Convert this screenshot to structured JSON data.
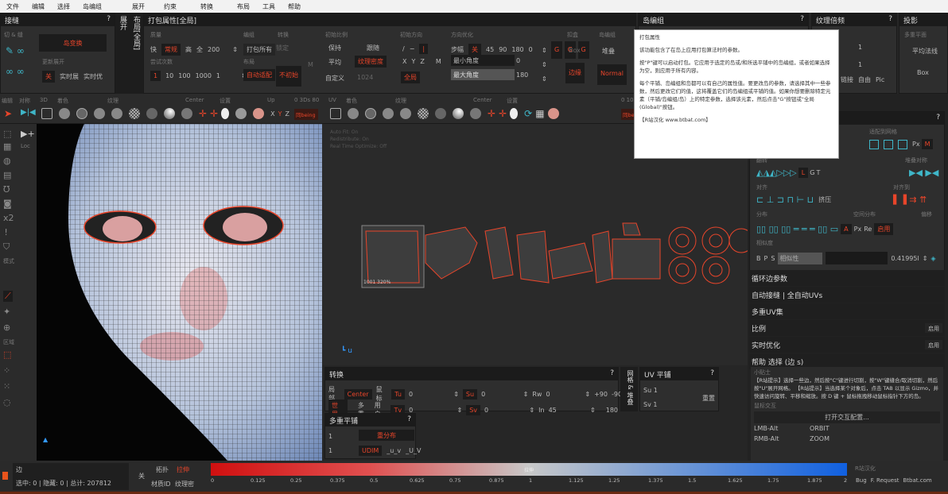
{
  "menu": [
    "文件",
    "编辑",
    "选择",
    "岛编组",
    "展开",
    "约束",
    "转换",
    "布局",
    "工具",
    "帮助"
  ],
  "seams": {
    "title": "接缝",
    "cut_label": "切 & 缝",
    "btn_main": "岛变换",
    "update_label": "更新展开",
    "off": "关",
    "realtime_ui": "实时展",
    "realtime_opt": "实时优"
  },
  "vtabs": {
    "unfold": "展开",
    "layout": "布局[全局]"
  },
  "pack": {
    "title": "打包属性[全局]",
    "quality": "质量",
    "fast": "快",
    "normal": "常规",
    "high": "高",
    "all": "全",
    "count": "200",
    "tries": "尝试次数",
    "tries_vals": [
      "1",
      "10",
      "100",
      "1000",
      "1"
    ],
    "orient": "编组",
    "pack_all": "打包所有",
    "layout": "布局",
    "auto_fit": "自动适配",
    "rotate": "转换",
    "lock": "锁定",
    "no_init": "不初始",
    "m": "M",
    "scale": "初始比例",
    "keep": "保持",
    "follow": "跟随",
    "avg": "平均",
    "tex_density": "纹理密度",
    "custom": "自定义",
    "custom_val": "1024",
    "dir": "初始方向",
    "dirs": [
      "/",
      "−",
      "|"
    ],
    "axes": [
      "X",
      "Y",
      "Z",
      "M"
    ],
    "global": "全局",
    "opt": "方向优化",
    "step": "步幅",
    "step_off": "关",
    "angles": [
      "45",
      "90",
      "180",
      "0"
    ],
    "min_angle": "最小角度",
    "min_val": "0",
    "max_angle": "最大角度",
    "max_val": "180",
    "g": "G",
    "box_h": "扣盒",
    "box": "Box",
    "edge": "边缘",
    "islgroup_h": "岛编组",
    "stack": "堆叠",
    "normal_mode": "Normal"
  },
  "islgroup": {
    "title": "岛编组"
  },
  "texmult": {
    "title": "纹理倍频",
    "v1": "1",
    "v2": "1",
    "b1": "链接",
    "b2": "自由",
    "b3": "Pic"
  },
  "projection": {
    "title": "投影",
    "multi": "多重平面",
    "avg": "平均法线",
    "box": "Box"
  },
  "tooltip": {
    "title": "打包属性",
    "p1": "该功能包含了在岛上应用打包算法时的参数。",
    "p2": "按\"P\"键可以启动打包。它应用于选定的岛或/和所选平铺中的岛编组，或者如果选择为空，则应用于所有内容。",
    "p3": "每个平铺、岛编组和岛都可以有自己的属性值。要更改岛的参数，请选择其中一些参数，然后更改它们的值，这将覆盖它们的岛编组或平铺的值。如果你想要删除特定元素（平铺/岛编组/岛）上的特定参数，选择该元素，然后点击\"G\"按钮或\"全局(Global)\"按钮。",
    "p4": "【R站汉化 www.btbat.com】"
  },
  "view3d": {
    "labels": [
      "编辑",
      "对称",
      "3D",
      "着色",
      "纹理",
      "Center",
      "设置",
      "Up",
      "0 3Ds 80"
    ],
    "axes": [
      "X",
      "Y",
      "Z"
    ],
    "same": "同being",
    "loc": "Loc",
    "x2": "x2",
    "mode": "模式",
    "region": "区域"
  },
  "viewuv": {
    "labels": [
      "UV",
      "着色",
      "纹理",
      "Center",
      "设置",
      "0 10"
    ],
    "info": [
      "Auto Fit: On",
      "Redistribute: On",
      "Real Time Optimize: Off"
    ],
    "tile": "1001 320%",
    "same": "同being"
  },
  "transform": {
    "title": "转换",
    "local": "局部",
    "center": "Center",
    "mouse": "鼠标",
    "world": "世界",
    "multi": "多重",
    "user": "用户",
    "tu": "Tu",
    "tv": "Tv",
    "su": "Su",
    "sv": "Sv",
    "rw": "Rw",
    "in": "In",
    "zero": "0",
    "in_val": "45",
    "p90": "+90",
    "m90": "-90",
    "r180": "180"
  },
  "vtab2": "网格 & 堆叠",
  "uvtile": {
    "title": "UV 平铺",
    "su": "Su 1",
    "sv": "Sv 1",
    "reset": "重置"
  },
  "multitile": {
    "title": "多重平铺",
    "v1": "1",
    "v2": "1",
    "redistribute": "重分布",
    "udim": "UDIM",
    "uv1": "_u_v",
    "uv2": "_U_V"
  },
  "right": {
    "stack_title": "堆叠",
    "match": "适配到网格",
    "stack_sym": "堆叠对称",
    "flip": "翻转",
    "lgt": [
      "L",
      "G",
      "T"
    ],
    "align": "对齐",
    "align_to": "对齐到",
    "press": "挤压",
    "distribute": "分布",
    "space": "空间分布",
    "offset": "偏移",
    "apx": [
      "A",
      "Px",
      "Re"
    ],
    "enable": "启用",
    "px": "Px",
    "m": "M",
    "similar": "相似度",
    "bps": [
      "B",
      "P",
      "S"
    ],
    "similarity": "相似性",
    "sim_val": "0.41995l",
    "rows": [
      "循环边参数",
      "自动接缝 | 全自动UVs",
      "多重UV集",
      "比例",
      "实时优化",
      "帮助 选择 (边 s)"
    ],
    "enable_btn": "启用",
    "tip_title": "小贴士",
    "tip_text": "【R站提示】选择一些边，然后按\"C\"键进行切割，按\"W\"键缝合/取消切割，然后按\"U\"展开网格。  【R站提示】当选择某个对象后，点击 TAB 以显示 Gizmo，并快速访问旋转、平移和缩放。按 D 键 + 鼠标拖拽移动鼠标指针下方的岛。",
    "interact": "鼠标交互",
    "open_cfg": "打开交互配置...",
    "binds": [
      [
        "LMB-Alt",
        "ORBIT"
      ],
      [
        "RMB-Alt",
        "ZOOM"
      ]
    ]
  },
  "status": {
    "mode": "边",
    "counts": "选中: 0 | 隐藏: 0 | 总计: 207812",
    "off": "关",
    "topo": "拓扑",
    "stretch": "拉伸",
    "mat": "材质ID",
    "texel": "纹理密",
    "bar_label": "拉伸",
    "ticks": [
      "0",
      "0.125",
      "0.25",
      "0.375",
      "0.5",
      "0.625",
      "0.75",
      "0.875",
      "1",
      "1.125",
      "1.25",
      "1.375",
      "1.5",
      "1.625",
      "1.75",
      "1.875",
      "2"
    ],
    "credit": "R站汉化",
    "bug": "Bug",
    "req": "F. Request",
    "site": "Btbat.com"
  }
}
